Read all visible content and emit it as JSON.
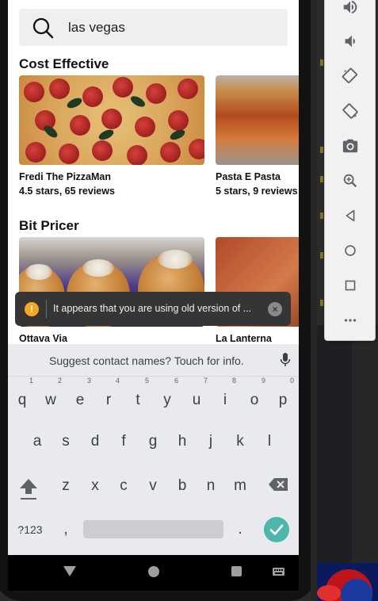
{
  "search": {
    "query": "las vegas"
  },
  "sections": [
    {
      "title": "Cost Effective",
      "cards": [
        {
          "name": "Fredi The PizzaMan",
          "rating": "4.5 stars, 65 reviews"
        },
        {
          "name": "Pasta E Pasta",
          "rating": "5 stars, 9 reviews"
        }
      ]
    },
    {
      "title": "Bit Pricer",
      "cards": [
        {
          "name": "Ottava Via",
          "rating": ""
        },
        {
          "name": "La Lanterna",
          "rating": ""
        }
      ]
    }
  ],
  "toast": {
    "message": "It appears that you are using old version of ...",
    "icon": "!",
    "close": "×"
  },
  "keyboard": {
    "suggestion": "Suggest contact names? Touch for info.",
    "row1": [
      "q",
      "w",
      "e",
      "r",
      "t",
      "y",
      "u",
      "i",
      "o",
      "p"
    ],
    "row1_nums": [
      "1",
      "2",
      "3",
      "4",
      "5",
      "6",
      "7",
      "8",
      "9",
      "0"
    ],
    "row2": [
      "a",
      "s",
      "d",
      "f",
      "g",
      "h",
      "j",
      "k",
      "l"
    ],
    "row3": [
      "z",
      "x",
      "c",
      "v",
      "b",
      "n",
      "m"
    ],
    "symbols": "?123",
    "comma": ",",
    "period": "."
  },
  "emulator_toolbar": [
    "volume-up-icon",
    "volume-down-icon",
    "rotate-left-icon",
    "rotate-right-icon",
    "camera-icon",
    "zoom-icon",
    "back-icon",
    "home-icon",
    "overview-icon",
    "more-icon"
  ],
  "colors": {
    "enter": "#4db6ac",
    "toast_bg": "#353535",
    "warning": "#f5a623"
  }
}
